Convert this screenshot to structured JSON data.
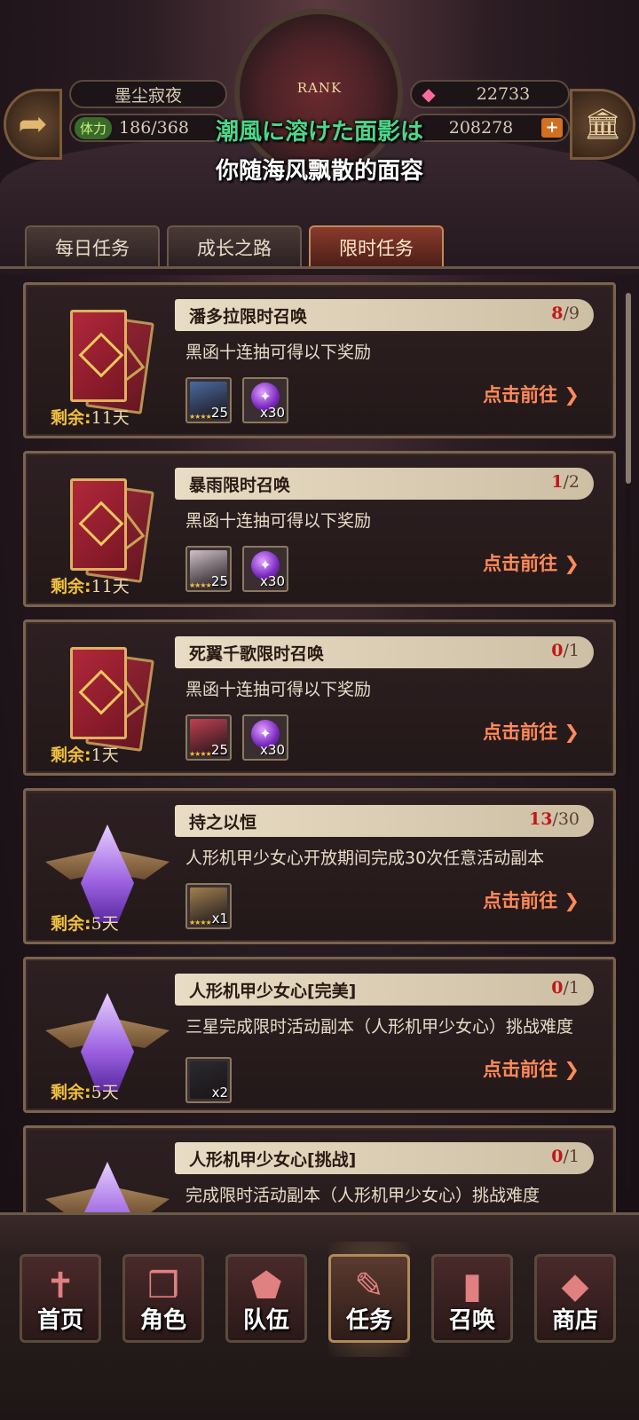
{
  "hud": {
    "rank_label": "RANK",
    "player_name": "墨尘寂夜",
    "stamina_tag": "体力",
    "stamina_value": "186/368",
    "gems": "22733",
    "gold": "208278",
    "back_icon": "back-arrow-icon",
    "bank_icon": "bank-icon"
  },
  "subtitles": {
    "japanese": "潮風に溶けた面影は",
    "chinese": "你随海风飘散的面容"
  },
  "tabs": [
    {
      "label": "每日任务",
      "active": false
    },
    {
      "label": "成长之路",
      "active": false
    },
    {
      "label": "限时任务",
      "active": true
    }
  ],
  "remain_label": "剩余:",
  "go_label": "点击前往",
  "quests": [
    {
      "title": "潘多拉限时召唤",
      "progress_current": "8",
      "progress_total": "/9",
      "desc": "黑函十连抽可得以下奖励",
      "remain": "11天",
      "art": "card",
      "rewards": [
        {
          "type": "character",
          "count": "25",
          "color": "#4a6aa0"
        },
        {
          "type": "orb",
          "count": "x30"
        }
      ]
    },
    {
      "title": "暴雨限时召唤",
      "progress_current": "1",
      "progress_total": "/2",
      "desc": "黑函十连抽可得以下奖励",
      "remain": "11天",
      "art": "card",
      "rewards": [
        {
          "type": "character",
          "count": "25",
          "color": "#d0c0c8"
        },
        {
          "type": "orb",
          "count": "x30"
        }
      ]
    },
    {
      "title": "死翼千歌限时召唤",
      "progress_current": "0",
      "progress_total": "/1",
      "desc": "黑函十连抽可得以下奖励",
      "remain": "1天",
      "art": "card",
      "rewards": [
        {
          "type": "character",
          "count": "25",
          "color": "#c04050"
        },
        {
          "type": "orb",
          "count": "x30"
        }
      ]
    },
    {
      "title": "持之以恒",
      "progress_current": "13",
      "progress_total": "/30",
      "desc": "人形机甲少女心开放期间完成30次任意活动副本",
      "remain": "5天",
      "art": "crystal",
      "rewards": [
        {
          "type": "character",
          "count": "x1",
          "color": "#a08050"
        }
      ]
    },
    {
      "title": "人形机甲少女心[完美]",
      "progress_current": "0",
      "progress_total": "/1",
      "desc": "三星完成限时活动副本（人形机甲少女心）挑战难度",
      "remain": "5天",
      "art": "crystal",
      "rewards": [
        {
          "type": "item",
          "count": "x2",
          "color": "#2a2a2e"
        }
      ]
    },
    {
      "title": "人形机甲少女心[挑战]",
      "progress_current": "0",
      "progress_total": "/1",
      "desc": "完成限时活动副本（人形机甲少女心）挑战难度",
      "remain": "",
      "art": "crystal",
      "rewards": []
    }
  ],
  "nav": [
    {
      "label": "首页",
      "icon": "home-banner-icon",
      "glyph": "✝",
      "active": false
    },
    {
      "label": "角色",
      "icon": "character-book-icon",
      "glyph": "❒",
      "active": false
    },
    {
      "label": "队伍",
      "icon": "team-emblem-icon",
      "glyph": "⬟",
      "active": false
    },
    {
      "label": "任务",
      "icon": "quest-quill-icon",
      "glyph": "✎",
      "active": true
    },
    {
      "label": "召唤",
      "icon": "summon-card-icon",
      "glyph": "▮",
      "active": false
    },
    {
      "label": "商店",
      "icon": "shop-gem-icon",
      "glyph": "◆",
      "active": false
    }
  ]
}
